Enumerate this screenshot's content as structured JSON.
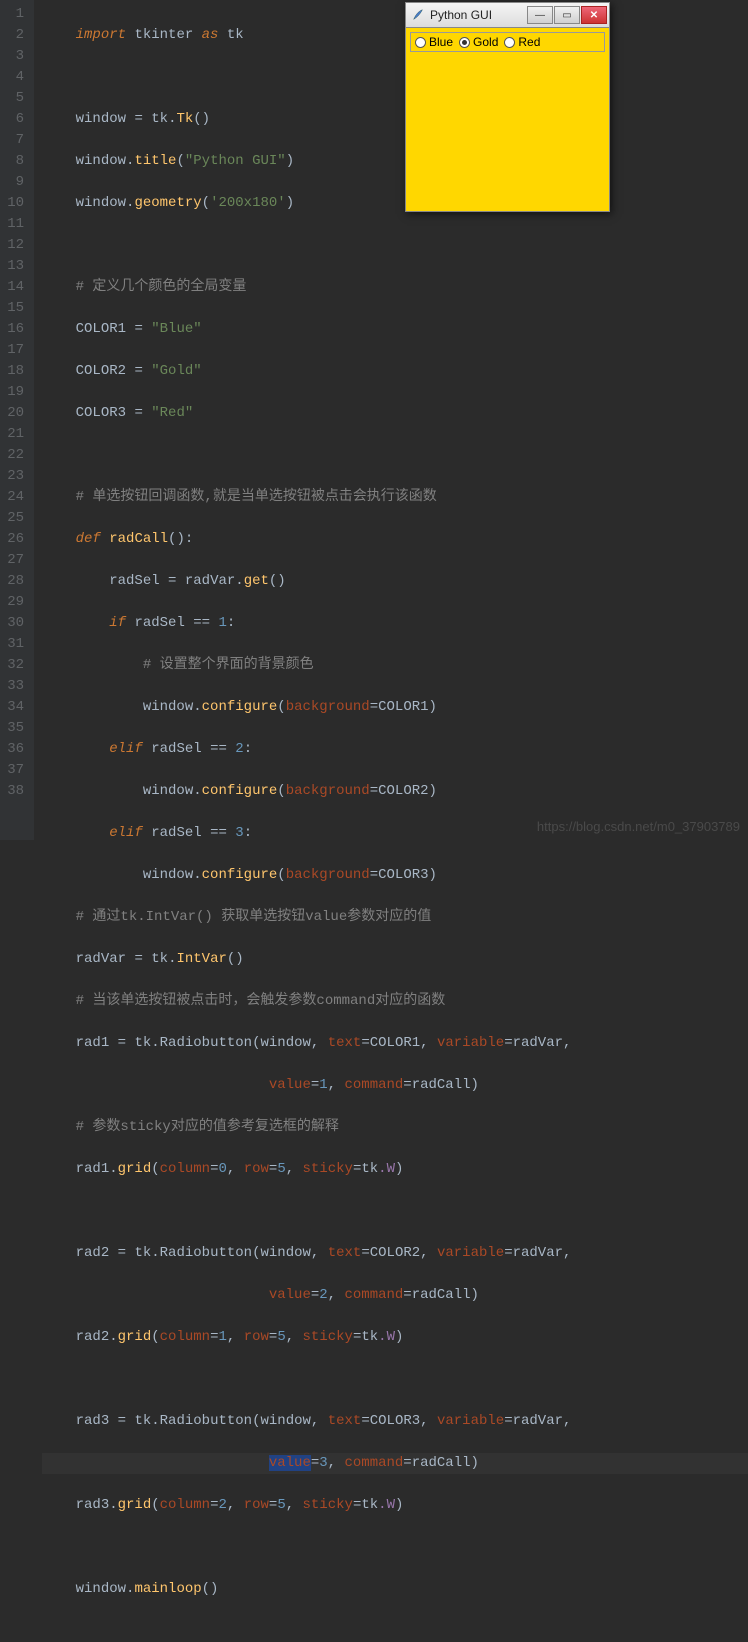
{
  "gui": {
    "title": "Python GUI",
    "radios": [
      {
        "label": "Blue",
        "selected": false
      },
      {
        "label": "Gold",
        "selected": true
      },
      {
        "label": "Red",
        "selected": false
      }
    ],
    "body_color": "#ffd700"
  },
  "watermark": "https://blog.csdn.net/m0_37903789",
  "lines": [
    1,
    2,
    3,
    4,
    5,
    6,
    7,
    8,
    9,
    10,
    11,
    12,
    13,
    14,
    15,
    16,
    17,
    18,
    19,
    20,
    21,
    22,
    23,
    24,
    25,
    26,
    27,
    28,
    29,
    30,
    31,
    32,
    33,
    34,
    35,
    36,
    37,
    38
  ],
  "code": {
    "l1": {
      "import": "import",
      "mod": "tkinter",
      "as": "as",
      "alias": "tk"
    },
    "l3": {
      "lhs": "window",
      "eq": "=",
      "obj": "tk",
      "dot": ".",
      "fn": "Tk",
      "paren": "()"
    },
    "l4": {
      "obj": "window",
      "dot": ".",
      "fn": "title",
      "open": "(",
      "str": "\"Python GUI\"",
      "close": ")"
    },
    "l5": {
      "obj": "window",
      "dot": ".",
      "fn": "geometry",
      "open": "(",
      "str": "'200x180'",
      "close": ")"
    },
    "l7": {
      "c": "# 定义几个颜色的全局变量"
    },
    "l8": {
      "lhs": "COLOR1",
      "eq": "=",
      "str": "\"Blue\""
    },
    "l9": {
      "lhs": "COLOR2",
      "eq": "=",
      "str": "\"Gold\""
    },
    "l10": {
      "lhs": "COLOR3",
      "eq": "=",
      "str": "\"Red\""
    },
    "l12": {
      "c": "# 单选按钮回调函数,就是当单选按钮被点击会执行该函数"
    },
    "l13": {
      "def": "def",
      "fn": "radCall",
      "paren": "():"
    },
    "l14": {
      "lhs": "radSel",
      "eq": "=",
      "obj": "radVar",
      "dot": ".",
      "fn": "get",
      "paren": "()"
    },
    "l15": {
      "if": "if",
      "cond": "radSel",
      "op": "==",
      "num": "1",
      "colon": ":"
    },
    "l16": {
      "c": "# 设置整个界面的背景颜色"
    },
    "l17": {
      "obj": "window",
      "dot": ".",
      "fn": "configure",
      "open": "(",
      "param": "background",
      "eq": "=",
      "val": "COLOR1",
      "close": ")"
    },
    "l18": {
      "elif": "elif",
      "cond": "radSel",
      "op": "==",
      "num": "2",
      "colon": ":"
    },
    "l19": {
      "obj": "window",
      "dot": ".",
      "fn": "configure",
      "open": "(",
      "param": "background",
      "eq": "=",
      "val": "COLOR2",
      "close": ")"
    },
    "l20": {
      "elif": "elif",
      "cond": "radSel",
      "op": "==",
      "num": "3",
      "colon": ":"
    },
    "l21": {
      "obj": "window",
      "dot": ".",
      "fn": "configure",
      "open": "(",
      "param": "background",
      "eq": "=",
      "val": "COLOR3",
      "close": ")"
    },
    "l22": {
      "c": "# 通过tk.IntVar() 获取单选按钮value参数对应的值"
    },
    "l23": {
      "lhs": "radVar",
      "eq": "=",
      "obj": "tk",
      "dot": ".",
      "fn": "IntVar",
      "paren": "()"
    },
    "l24": {
      "c": "# 当该单选按钮被点击时，会触发参数command对应的函数"
    },
    "l25": {
      "lhs": "rad1",
      "eq": "=",
      "obj": "tk",
      "dot": ".",
      "fn": "Radiobutton",
      "open": "(",
      "a1": "window",
      "c1": ",",
      "p1": "text",
      "e1": "=",
      "v1": "COLOR1",
      "c2": ",",
      "p2": "variable",
      "e2": "=",
      "v2": "radVar",
      "c3": ","
    },
    "l26": {
      "p1": "value",
      "e1": "=",
      "v1": "1",
      "c1": ",",
      "p2": "command",
      "e2": "=",
      "v2": "radCall",
      "close": ")"
    },
    "l27": {
      "c": "# 参数sticky对应的值参考复选框的解释"
    },
    "l28": {
      "obj": "rad1",
      "dot": ".",
      "fn": "grid",
      "open": "(",
      "p1": "column",
      "e1": "=",
      "v1": "0",
      "c1": ",",
      "p2": "row",
      "e2": "=",
      "v2": "5",
      "c2": ",",
      "p3": "sticky",
      "e3": "=",
      "v3a": "tk",
      "v3b": ".W",
      "close": ")"
    },
    "l30": {
      "lhs": "rad2",
      "eq": "=",
      "obj": "tk",
      "dot": ".",
      "fn": "Radiobutton",
      "open": "(",
      "a1": "window",
      "c1": ",",
      "p1": "text",
      "e1": "=",
      "v1": "COLOR2",
      "c2": ",",
      "p2": "variable",
      "e2": "=",
      "v2": "radVar",
      "c3": ","
    },
    "l31": {
      "p1": "value",
      "e1": "=",
      "v1": "2",
      "c1": ",",
      "p2": "command",
      "e2": "=",
      "v2": "radCall",
      "close": ")"
    },
    "l32": {
      "obj": "rad2",
      "dot": ".",
      "fn": "grid",
      "open": "(",
      "p1": "column",
      "e1": "=",
      "v1": "1",
      "c1": ",",
      "p2": "row",
      "e2": "=",
      "v2": "5",
      "c2": ",",
      "p3": "sticky",
      "e3": "=",
      "v3a": "tk",
      "v3b": ".W",
      "close": ")"
    },
    "l34": {
      "lhs": "rad3",
      "eq": "=",
      "obj": "tk",
      "dot": ".",
      "fn": "Radiobutton",
      "open": "(",
      "a1": "window",
      "c1": ",",
      "p1": "text",
      "e1": "=",
      "v1": "COLOR3",
      "c2": ",",
      "p2": "variable",
      "e2": "=",
      "v2": "radVar",
      "c3": ","
    },
    "l35": {
      "p1": "value",
      "e1": "=",
      "v1": "3",
      "c1": ",",
      "p2": "command",
      "e2": "=",
      "v2": "radCall",
      "close": ")"
    },
    "l36": {
      "obj": "rad3",
      "dot": ".",
      "fn": "grid",
      "open": "(",
      "p1": "column",
      "e1": "=",
      "v1": "2",
      "c1": ",",
      "p2": "row",
      "e2": "=",
      "v2": "5",
      "c2": ",",
      "p3": "sticky",
      "e3": "=",
      "v3a": "tk",
      "v3b": ".W",
      "close": ")"
    },
    "l38": {
      "obj": "window",
      "dot": ".",
      "fn": "mainloop",
      "paren": "()"
    }
  }
}
